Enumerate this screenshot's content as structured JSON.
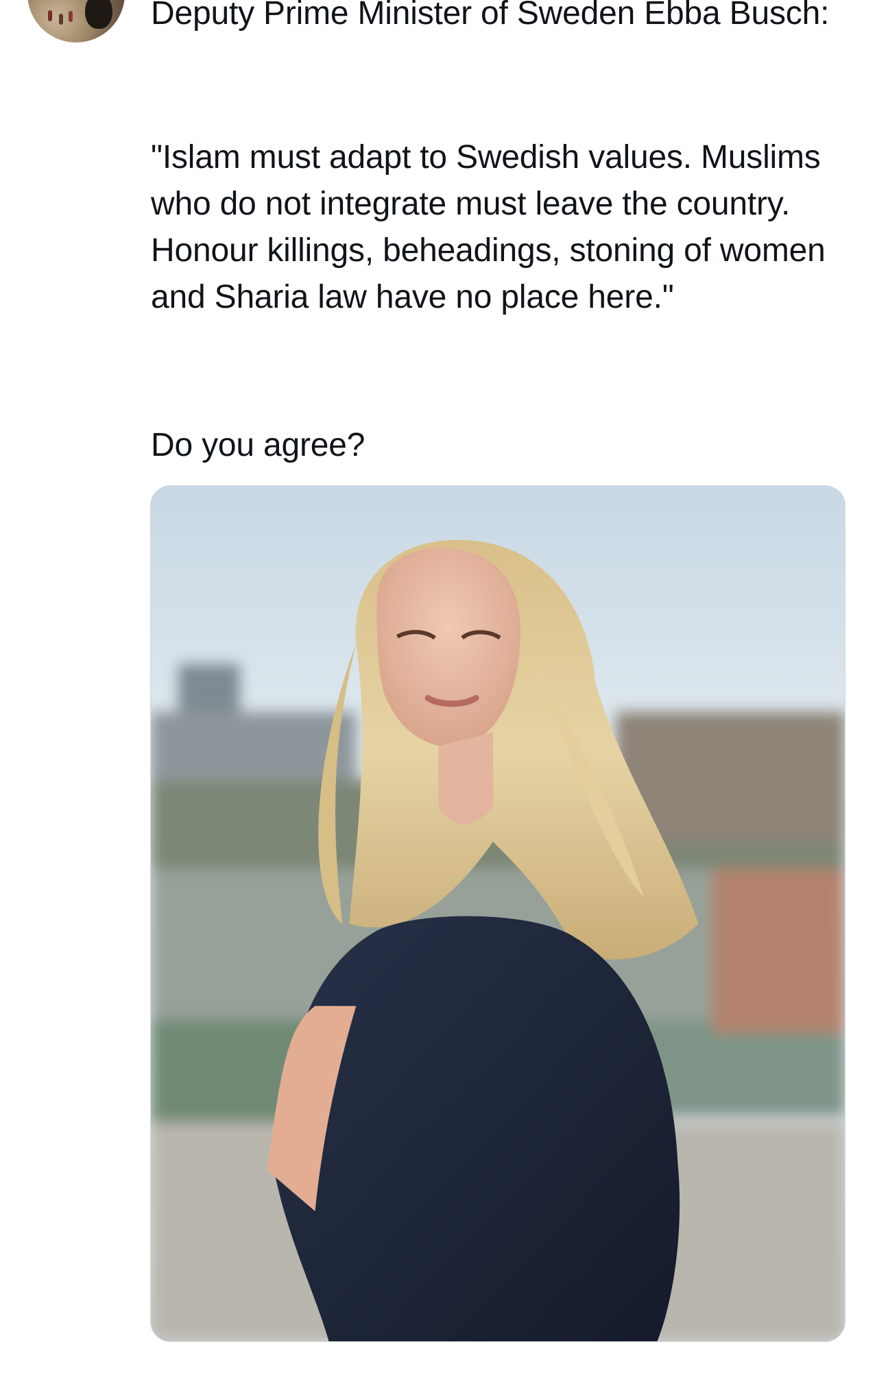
{
  "tweet": {
    "heading": "Deputy Prime Minister of Sweden Ebba Busch:",
    "quote": "\"Islam must adapt to Swedish values. Muslims who do not integrate must leave the country. Honour killings, beheadings, stoning of women and Sharia law have no place here.\"",
    "question": "Do you agree?"
  },
  "icons": {
    "avatar": "user-avatar",
    "photo": "portrait-photo"
  },
  "colors": {
    "text": "#0f1419",
    "background": "#ffffff",
    "photo_border": "#cfd9de"
  }
}
